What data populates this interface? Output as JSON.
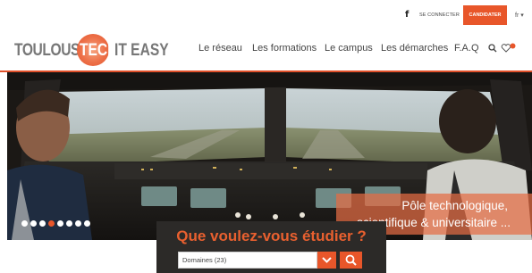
{
  "topbar": {
    "facebook_icon": "facebook-icon",
    "login_label": "SE CONNECTER",
    "apply_label": "CANDIDATER",
    "language_label": "fr ▾"
  },
  "logo": {
    "part1": "TOULOUSE",
    "part2": "TECH",
    "part3": "IT EASY"
  },
  "nav": {
    "items": [
      {
        "label": "Le réseau"
      },
      {
        "label": "Les formations"
      },
      {
        "label": "Le campus"
      },
      {
        "label": "Les démarches"
      },
      {
        "label": "F.A.Q"
      }
    ],
    "search_icon": "search-icon",
    "favorites_icon": "heart-icon"
  },
  "hero": {
    "caption_line1": "Pôle technologique,",
    "caption_line2": "scientifique & universitaire ...",
    "slide_count": 8,
    "active_slide": 4
  },
  "search": {
    "title": "Que voulez-vous étudier ?",
    "select_value": "Domaines (23)",
    "dropdown_icon": "chevron-down-icon",
    "submit_icon": "search-icon"
  },
  "colors": {
    "accent": "#e8562a",
    "dark_panel": "#2c2a28"
  }
}
